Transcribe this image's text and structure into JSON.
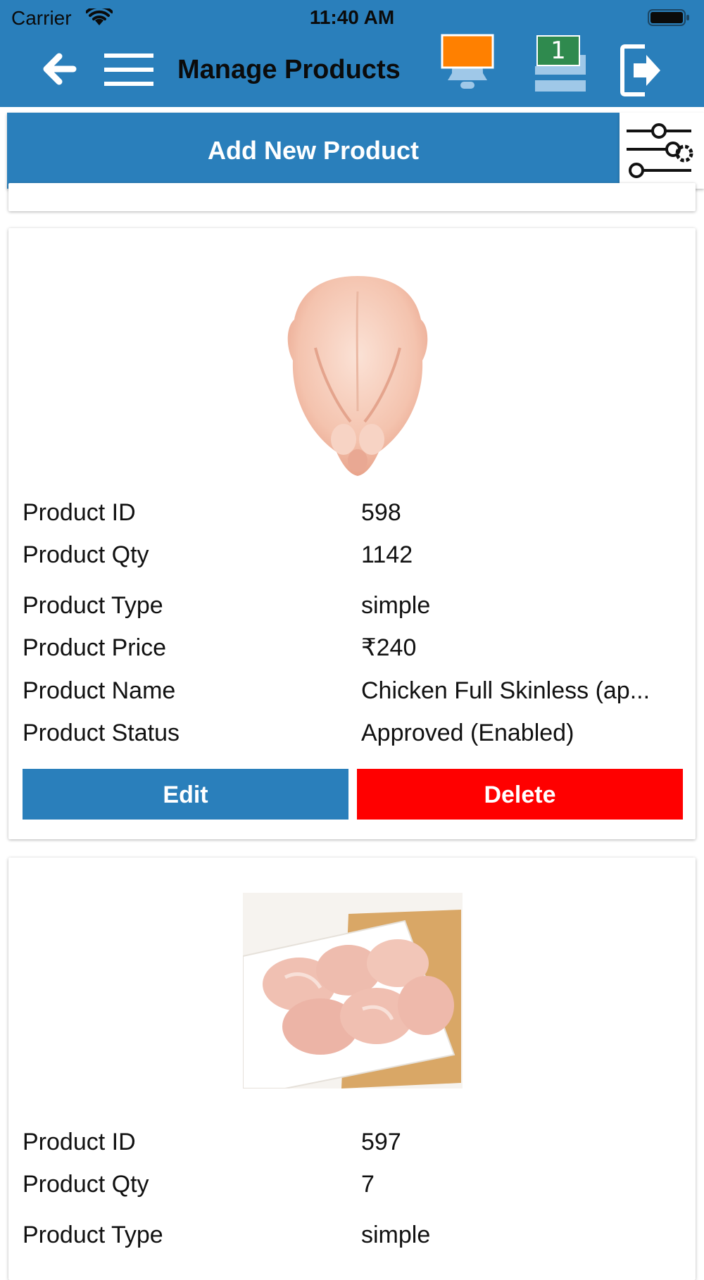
{
  "status_bar": {
    "carrier": "Carrier",
    "time": "11:40 AM"
  },
  "header": {
    "title": "Manage Products",
    "cart_count": "1",
    "icons": {
      "back": "arrow-left-icon",
      "menu": "hamburger-menu-icon",
      "notifications": "bell-icon",
      "cart": "cart-icon",
      "logout": "logout-icon"
    },
    "bell_indicator_color": "#ff8000"
  },
  "toolbar": {
    "add_label": "Add New Product",
    "filter_icon": "filter-sliders-icon"
  },
  "products": [
    {
      "fields": [
        {
          "label": "Product ID",
          "value": "598"
        },
        {
          "label": "Product Qty",
          "value": "1142"
        },
        {
          "label": "Product Type",
          "value": "simple"
        },
        {
          "label": "Product Price",
          "value": "₹240"
        },
        {
          "label": "Product Name",
          "value": "Chicken Full Skinless (ap..."
        },
        {
          "label": "Product Status",
          "value": "Approved (Enabled)"
        }
      ],
      "edit_label": "Edit",
      "delete_label": "Delete"
    },
    {
      "fields": [
        {
          "label": "Product ID",
          "value": "597"
        },
        {
          "label": "Product Qty",
          "value": "7"
        },
        {
          "label": "Product Type",
          "value": "simple"
        }
      ]
    }
  ],
  "colors": {
    "primary": "#2a7fbb",
    "danger": "#ff0000",
    "badge": "#2f8a4e"
  }
}
